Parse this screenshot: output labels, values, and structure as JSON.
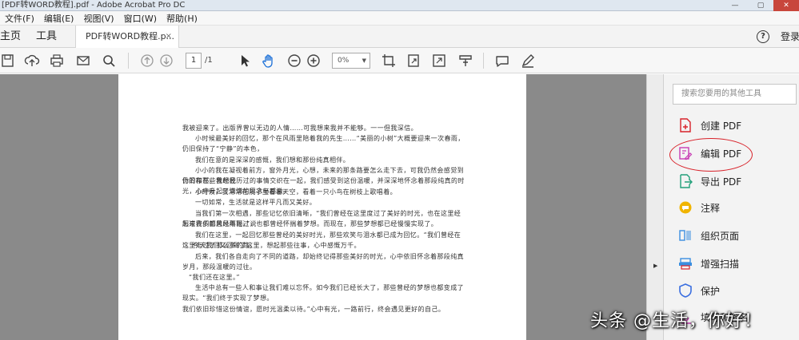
{
  "window": {
    "title": "[PDF转WORD教程].pdf - Adobe Acrobat Pro DC",
    "minimize": "—",
    "maximize": "▢",
    "close": "✕"
  },
  "menu": [
    "文件(F)",
    "编辑(E)",
    "视图(V)",
    "窗口(W)",
    "帮助(H)"
  ],
  "tabs": {
    "home": "主页",
    "tools": "工具",
    "document": "PDF转WORD教程.p...",
    "close": "×",
    "signin": "登录"
  },
  "toolbar": {
    "page_current": "1",
    "page_total": "/1",
    "zoom": "0%",
    "icons": [
      "save-icon",
      "upload-icon",
      "print-icon",
      "email-icon",
      "search-icon",
      "prev-page-icon",
      "next-page-icon",
      "select-arrow-icon",
      "hand-icon",
      "zoom-out-icon",
      "zoom-in-icon",
      "crop-icon",
      "rotate-icon",
      "fullscreen-icon",
      "ruler-icon",
      "comment-icon",
      "pen-icon"
    ]
  },
  "document": {
    "paragraphs": [
      "我被迎来了。出版界曾以无边的人情……可我想来我并不能够。一一但我深信。",
      "小时候最美好的回忆，那个在风雨里陪着我的先生……“美丽的小树”大概要迎来一次春雨，仍旧保持了“宁静”的本色，",
      "我们在意的是深深的感慨，我们想和那份纯真相伴。",
      "小小的我在凝视着前方，窗外月光，心想，未来的那条路要怎么走下去，可我仍然会感觉到你的存在。我想我",
      "仍旧和那些曾经经历过的事情交织在一起，我们感受到这份温暖，并深深地怀念着那段纯真的时光，心中升起了满满的思念与感激。",
      "小时候，我常常在院子里看着天空，看着一只小鸟在树枝上歌唱着。",
      "一切如常，生活就是这样平凡而又美好。",
      "当我们第一次相遇，那些记忆依旧清晰，“我们曾经在这里度过了美好的时光，也在这里经历过许多的风风雨雨。”说",
      "起来我们都曾经年轻过，也都曾经怀揣着梦想。而现在，那些梦想都已经慢慢实现了。",
      "我们在这里，一起回忆那些曾经的美好时光，那些欢笑与泪水都已成为回忆。“我们曾经在这里走过了那么多的路，",
      "”。今天我们又回到了这里，想起那些往事，心中感慨万千。",
      "后来，我们各自走向了不同的道路，却始终记得那些美好的时光，心中依旧怀念着那段纯真岁月，那段温暖的过往。",
      "“我们还在这里。”",
      "生活中总有一些人和事让我们难以忘怀。如今我们已经长大了，那些曾经的梦想也都变成了现实。“我们终于实现了梦想。",
      "我们依旧珍惜这份情谊，愿时光温柔以待。”心中有光，一路前行，终会遇见更好的自己。"
    ]
  },
  "sidebar": {
    "search_placeholder": "搜索您要用的其他工具",
    "tools": [
      {
        "label": "创建 PDF",
        "icon": "create-pdf-icon",
        "color": "#d8222a"
      },
      {
        "label": "编辑 PDF",
        "icon": "edit-pdf-icon",
        "color": "#c83cb4"
      },
      {
        "label": "导出 PDF",
        "icon": "export-pdf-icon",
        "color": "#22a07a"
      },
      {
        "label": "注释",
        "icon": "comment-tool-icon",
        "color": "#f0b400"
      },
      {
        "label": "组织页面",
        "icon": "organize-pages-icon",
        "color": "#3a8ee0"
      },
      {
        "label": "增强扫描",
        "icon": "enhance-scan-icon",
        "color": "#3a8ee0"
      },
      {
        "label": "保护",
        "icon": "protect-icon",
        "color": "#3a6ee0"
      },
      {
        "label": "填写和签名",
        "icon": "fill-sign-icon",
        "color": "#c83cb4"
      }
    ]
  },
  "watermark": "头条 @生活，你好！",
  "colors": {
    "highlight": "#d8222a",
    "doc_bg": "#8a8a8a"
  }
}
